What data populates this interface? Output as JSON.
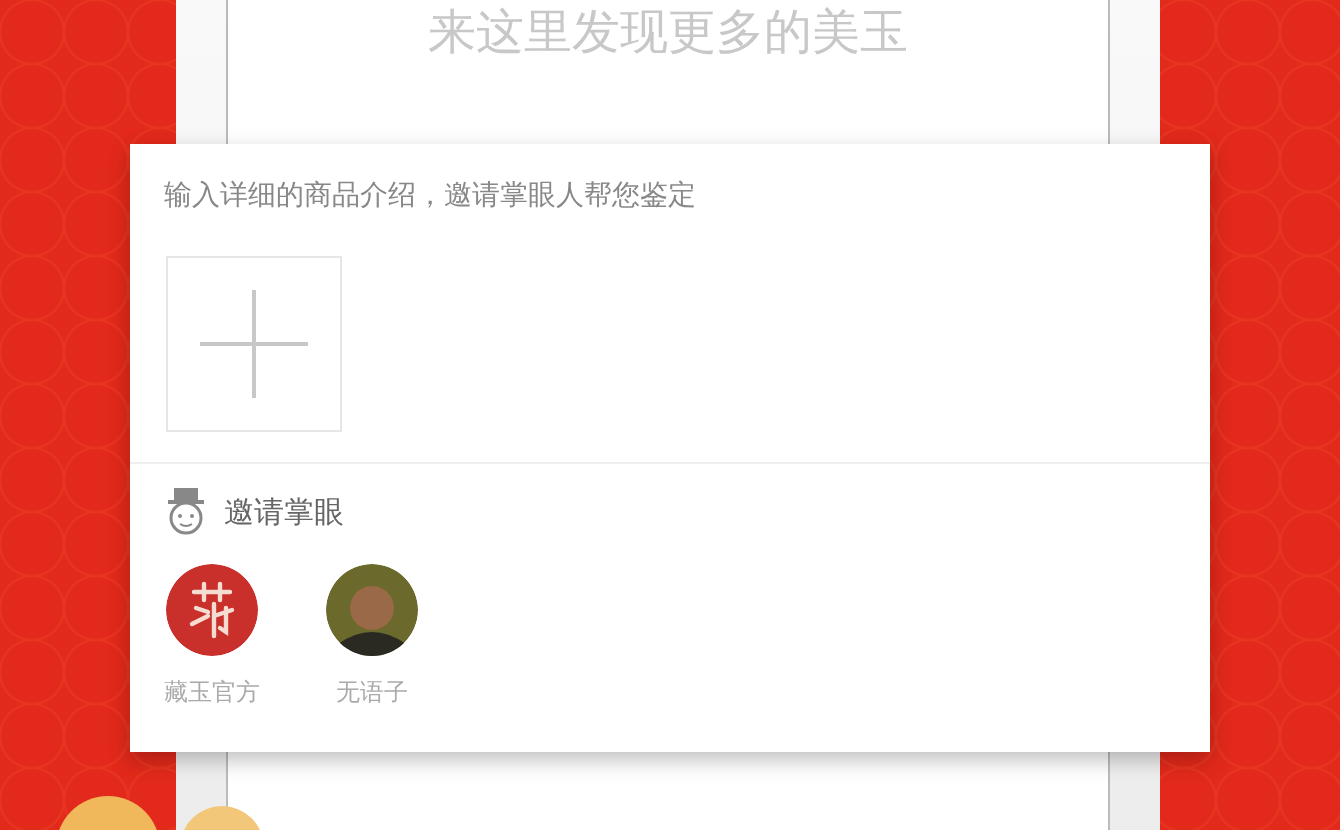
{
  "banner": {
    "title": "来这里发现更多的美玉"
  },
  "dialog": {
    "description": {
      "placeholder": "输入详细的商品介绍，邀请掌眼人帮您鉴定"
    },
    "invite": {
      "title": "邀请掌眼"
    },
    "experts": [
      {
        "name": "藏玉官方",
        "kind": "logo"
      },
      {
        "name": "无语子",
        "kind": "photo"
      }
    ]
  }
}
